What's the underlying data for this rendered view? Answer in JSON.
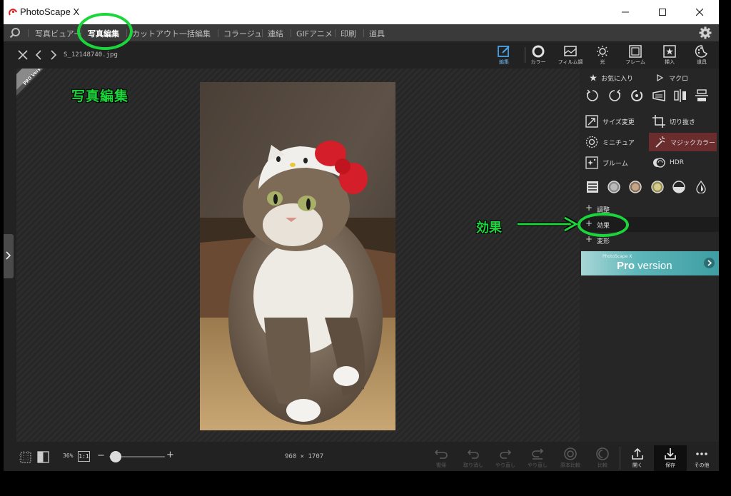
{
  "app": {
    "title": "PhotoScape X"
  },
  "menu": {
    "items": [
      "写真ビュアー",
      "写真編集",
      "カットアウト",
      "一括編集",
      "コラージュ",
      "連結",
      "GIFアニメ",
      "印刷",
      "道具"
    ]
  },
  "toolbar": {
    "filename": "S_12148740.jpg",
    "tools": [
      {
        "label": "編集",
        "icon": "edit-icon",
        "active": true
      },
      {
        "label": "カラー",
        "icon": "color-icon"
      },
      {
        "label": "フィルム調",
        "icon": "film-icon"
      },
      {
        "label": "光",
        "icon": "light-icon"
      },
      {
        "label": "フレーム",
        "icon": "frame-icon"
      },
      {
        "label": "挿入",
        "icon": "insert-icon"
      },
      {
        "label": "道具",
        "icon": "tools-icon"
      }
    ]
  },
  "canvas": {
    "pro_ribbon": "PRO Version",
    "annotation_title": "写真編集",
    "annotation_effect": "効果"
  },
  "panel": {
    "favorites": "お気に入り",
    "macro": "マクロ",
    "tools": [
      {
        "label": "サイズ変更",
        "icon": "resize-icon"
      },
      {
        "label": "切り抜き",
        "icon": "crop-icon"
      },
      {
        "label": "ミニチュア",
        "icon": "miniature-icon"
      },
      {
        "label": "マジックカラー",
        "icon": "magic-color-icon"
      },
      {
        "label": "ブルーム",
        "icon": "bloom-icon"
      },
      {
        "label": "HDR",
        "icon": "hdr-icon"
      }
    ],
    "sections": [
      "調整",
      "効果",
      "変形"
    ],
    "pro_banner": {
      "small": "PhotoScape X",
      "big_bold": "Pro",
      "big": " version"
    }
  },
  "bottom": {
    "zoom": "36%",
    "ratio": "1:1",
    "minus": "−",
    "plus": "+",
    "dimensions": "960 × 1707",
    "buttons": [
      {
        "label": "復帰",
        "icon": "revert-icon",
        "enabled": false
      },
      {
        "label": "取り消し",
        "icon": "undo-icon",
        "enabled": false
      },
      {
        "label": "やり直し",
        "icon": "redo-icon",
        "enabled": false
      },
      {
        "label": "やり直し",
        "icon": "redo-all-icon",
        "enabled": false
      },
      {
        "label": "原本比較",
        "icon": "compare-original-icon",
        "enabled": false
      },
      {
        "label": "比較",
        "icon": "compare-icon",
        "enabled": false
      },
      {
        "label": "開く",
        "icon": "open-icon",
        "enabled": true
      },
      {
        "label": "保存",
        "icon": "save-icon",
        "enabled": true
      },
      {
        "label": "その他",
        "icon": "more-icon",
        "enabled": true
      }
    ]
  },
  "colors": {
    "accent_green": "#1bd63a",
    "active_blue": "#4aa3e8",
    "magic_bg": "#6a2c2c",
    "pro_teal": "#5fb7ba"
  }
}
